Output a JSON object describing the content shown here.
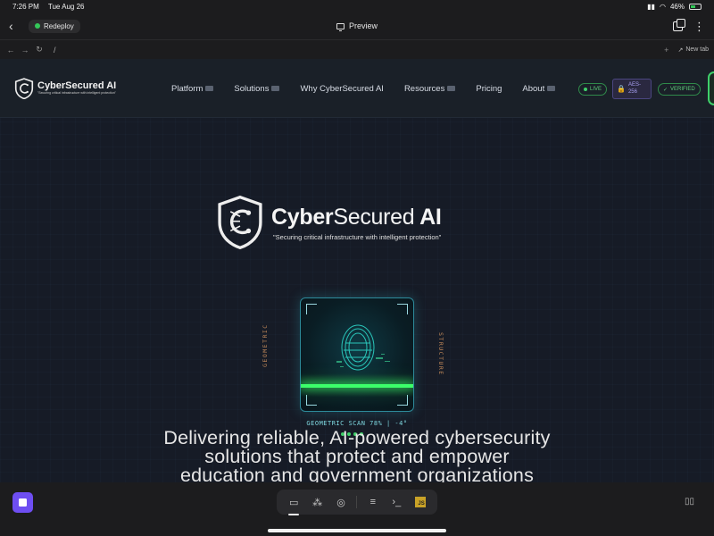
{
  "status_bar": {
    "time": "7:26 PM",
    "date": "Tue Aug 26",
    "battery": "46%"
  },
  "app_toolbar": {
    "redeploy_label": "Redeploy",
    "preview_label": "Preview"
  },
  "url_bar": {
    "path": "/",
    "new_tab_label": "New tab"
  },
  "site": {
    "logo_name": "CyberSecured AI",
    "logo_tagline": "\"Securing critical infrastructure with intelligent protection\"",
    "nav": [
      "Platform",
      "Solutions",
      "Why CyberSecured AI",
      "Resources",
      "Pricing",
      "About"
    ],
    "badges": {
      "live": "LIVE",
      "aes": "AES-256",
      "verified": "VERIFIED"
    }
  },
  "hero": {
    "title_bold": "Cyber",
    "title_rest": "Secured",
    "title_ai": "AI",
    "tagline": "\"Securing critical infrastructure with intelligent protection\"",
    "scanner_left_label": "GEOMETRIC",
    "scanner_right_label": "STRUCTURE",
    "scan_status": "GEOMETRIC SCAN 78% | -4°",
    "headline_line1": "Delivering reliable, AI-powered cybersecurity",
    "headline_line2": "solutions that protect and empower",
    "headline_line3": "education and government organizations"
  },
  "colors": {
    "accent_green": "#3cff6a",
    "scanner_cyan": "#2d8a9a",
    "stop_button": "#6e4ef2"
  }
}
